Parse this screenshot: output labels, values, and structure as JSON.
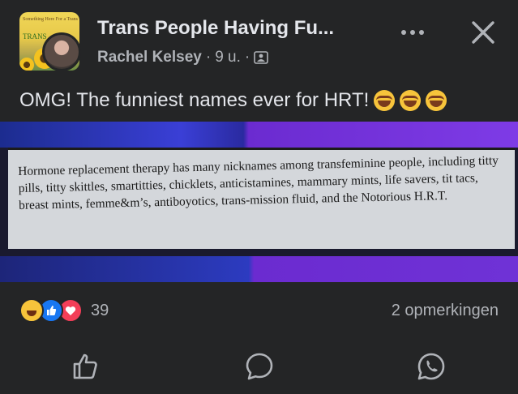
{
  "post": {
    "group_name": "Trans People Having Fu...",
    "group_avatar_text": "Something Here For a Trans",
    "group_avatar_badge": "TRANS",
    "author": "Rachel Kelsey",
    "separator": "·",
    "time": "9 u.",
    "separator2": "·",
    "caption": "OMG! The funniest names ever for HRT!",
    "image_text": "Hormone replacement therapy has many nicknames among transfeminine people, including titty pills, titty skittles, smartitties, chicklets, anticistamines, mammary mints, life savers, tit tacs, breast mints, femme&m’s, antiboyotics, trans-mission fluid, and the Notorious H.R.T."
  },
  "engagement": {
    "reaction_count": "39",
    "comments": "2 opmerkingen"
  },
  "icons": {
    "more": "more-dots-icon",
    "close": "close-icon",
    "audience": "friends-audience-icon",
    "like": "like-icon",
    "comment": "comment-icon",
    "share": "whatsapp-icon"
  },
  "colors": {
    "background": "#242526",
    "text_primary": "#e4e6eb",
    "text_secondary": "#b0b3b8",
    "like_blue": "#1877f2",
    "love_red": "#f33e58",
    "haha_yellow": "#f7c43b"
  }
}
